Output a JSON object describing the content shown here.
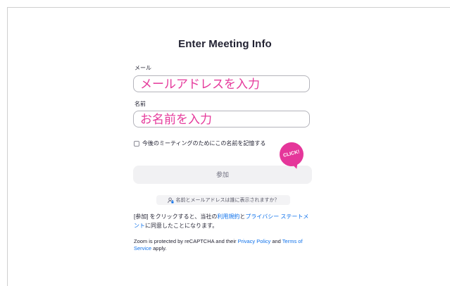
{
  "title": "Enter Meeting Info",
  "email": {
    "label": "メール",
    "placeholder": "メールアドレスを入力"
  },
  "name": {
    "label": "名前",
    "placeholder": "お名前を入力"
  },
  "remember": {
    "label": "今後のミーティングのためにこの名前を記憶する",
    "checked": false
  },
  "join_button": {
    "label": "参加"
  },
  "click_badge": {
    "text": "CLICK!",
    "color": "#e5369a"
  },
  "privacy_question": {
    "icon": "user-lock-icon",
    "text": "名前とメールアドレスは誰に表示されますか？"
  },
  "consent": {
    "prefix": "[参加] をクリックすると、当社の",
    "terms_link": "利用規約",
    "and": "と",
    "privacy_link": "プライバシー ステートメント",
    "suffix": "に同意したことになります。"
  },
  "recaptcha": {
    "prefix": "Zoom is protected by reCAPTCHA and their ",
    "privacy_link": "Privacy Policy",
    "and": " and ",
    "terms_link": "Terms of Service",
    "suffix": " apply."
  },
  "colors": {
    "link": "#0e71eb",
    "accent": "#e5399b"
  }
}
